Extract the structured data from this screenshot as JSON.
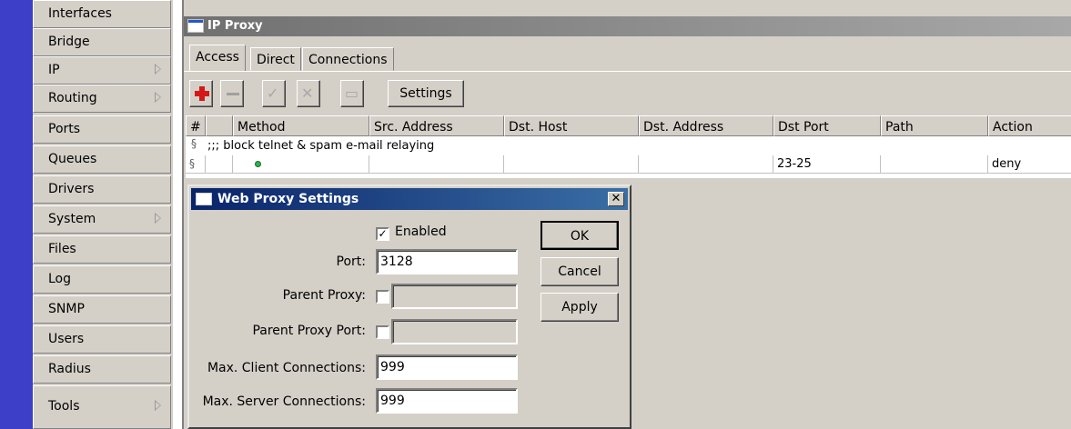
{
  "sidebar": {
    "items": [
      {
        "label": "Interfaces",
        "submenu": false
      },
      {
        "label": "Bridge",
        "submenu": false
      },
      {
        "label": "IP",
        "submenu": true
      },
      {
        "label": "Routing",
        "submenu": true
      },
      {
        "label": "Ports",
        "submenu": false
      },
      {
        "label": "Queues",
        "submenu": false
      },
      {
        "label": "Drivers",
        "submenu": false
      },
      {
        "label": "System",
        "submenu": true
      },
      {
        "label": "Files",
        "submenu": false
      },
      {
        "label": "Log",
        "submenu": false
      },
      {
        "label": "SNMP",
        "submenu": false
      },
      {
        "label": "Users",
        "submenu": false
      },
      {
        "label": "Radius",
        "submenu": false
      },
      {
        "label": "Tools",
        "submenu": true
      }
    ]
  },
  "window": {
    "title": "IP Proxy",
    "tabs": [
      "Access",
      "Direct",
      "Connections"
    ],
    "active_tab": "Access",
    "toolbar": {
      "settings_label": "Settings",
      "icons": [
        "add-icon",
        "remove-icon",
        "enable-icon",
        "disable-icon",
        "comment-icon"
      ]
    },
    "table": {
      "columns": [
        "#",
        "Method",
        "Src. Address",
        "Dst. Host",
        "Dst. Address",
        "Dst Port",
        "Path",
        "Action"
      ],
      "comment": ";;; block telnet & spam e-mail relaying",
      "rows": [
        {
          "num": "",
          "method": "",
          "src": "",
          "dsthost": "",
          "dstaddr": "",
          "dstport": "23-25",
          "path": "",
          "action": "deny"
        }
      ]
    }
  },
  "dialog": {
    "title": "Web Proxy Settings",
    "enabled_label": "Enabled",
    "enabled": true,
    "fields": {
      "port_label": "Port:",
      "port_value": "3128",
      "parent_proxy_label": "Parent Proxy:",
      "parent_proxy_value": "",
      "parent_proxy_port_label": "Parent Proxy Port:",
      "parent_proxy_port_value": "",
      "max_client_label": "Max. Client Connections:",
      "max_client_value": "999",
      "max_server_label": "Max. Server Connections:",
      "max_server_value": "999"
    },
    "buttons": {
      "ok": "OK",
      "cancel": "Cancel",
      "apply": "Apply"
    }
  },
  "colors": {
    "accent_strip": "#3d3fc8",
    "dialog_title": "#0a246a",
    "status_dot": "#2cb44a",
    "add_icon": "#d41818"
  }
}
